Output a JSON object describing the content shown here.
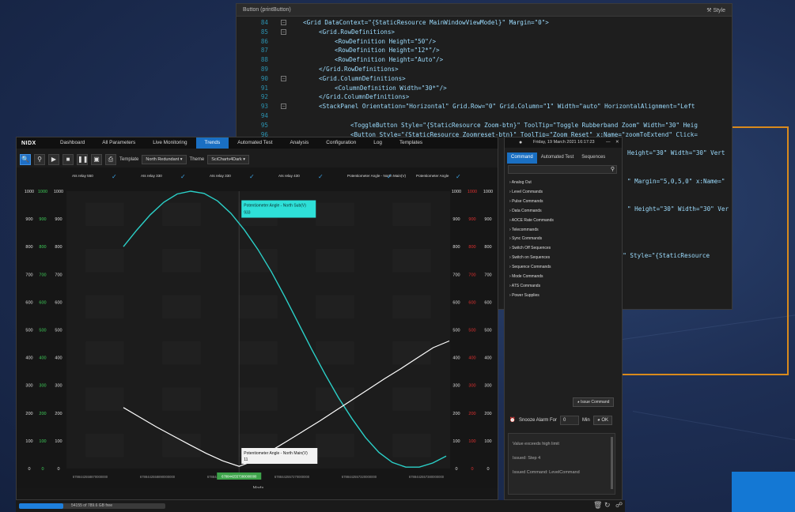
{
  "code_window": {
    "title": "Button (printButton)",
    "right_label": "Style",
    "lines": [
      {
        "num": "84",
        "code": "<Grid  DataContext=\"{StaticResource MainWindowViewModel}\" Margin=\"0\">"
      },
      {
        "num": "85",
        "code": "<Grid.RowDefinitions>"
      },
      {
        "num": "86",
        "code": "<RowDefinition Height=\"50\"/>"
      },
      {
        "num": "87",
        "code": "<RowDefinition Height=\"12*\"/>"
      },
      {
        "num": "88",
        "code": "<RowDefinition Height=\"Auto\"/>"
      },
      {
        "num": "89",
        "code": "</Grid.RowDefinitions>"
      },
      {
        "num": "90",
        "code": "<Grid.ColumnDefinitions>"
      },
      {
        "num": "91",
        "code": "<ColumnDefinition Width=\"30*\"/>"
      },
      {
        "num": "92",
        "code": "</Grid.ColumnDefinitions>"
      },
      {
        "num": "93",
        "code": "<StackPanel Orientation=\"Horizontal\" Grid.Row=\"0\" Grid.Column=\"1\" Width=\"auto\" HorizontalAlignment=\"Left"
      },
      {
        "num": "94",
        "code": ""
      },
      {
        "num": "95",
        "code": "<ToggleButton Style=\"{StaticResource Zoom-btn}\" ToolTip=\"Toggle Rubberband Zoom\" Width=\"30\" Heig"
      },
      {
        "num": "96",
        "code": "<Button Style=\"{StaticResource Zoomreset-btn}\" ToolTip=\"Zoom Reset\" x:Name=\"zoomToExtend\" Click="
      },
      {
        "num": "97",
        "code": ""
      },
      {
        "num": "98",
        "code": "Height=\"30\" Width=\"30\" Vert"
      },
      {
        "num": "99",
        "code": ""
      },
      {
        "num": "100",
        "code": ""
      },
      {
        "num": "101",
        "code": "\" Margin=\"5,0,5,0\" x:Name=\""
      },
      {
        "num": "102",
        "code": ""
      },
      {
        "num": "103",
        "code": ""
      },
      {
        "num": "104",
        "code": "\" Height=\"30\" Width=\"30\" Ver"
      },
      {
        "num": "105",
        "code": ""
      },
      {
        "num": "106",
        "code": ""
      },
      {
        "num": "107",
        "code": ""
      },
      {
        "num": "108",
        "code": ""
      },
      {
        "num": "109",
        "code": "nter\" Style=\"{StaticResource"
      }
    ]
  },
  "app": {
    "logo": "NIDX",
    "menu": [
      "Dashboard",
      "All Parameters",
      "Live Monitoring",
      "Trends",
      "Automated Test",
      "Analysis",
      "Configuration",
      "Log",
      "Templates"
    ],
    "active_menu": "Trends",
    "toolbar": {
      "template_label": "Template",
      "template_value": "North Redundant",
      "theme_label": "Theme",
      "theme_value": "SciChartv4Dark"
    },
    "series_headers": [
      "Ats relay 550",
      "Ats relay 330",
      "Ats relay 330",
      "Ats relay 430",
      "Potentiometer Angle - North Main(V)",
      "Potentiometer Angle"
    ],
    "x_axis_title": "Mods",
    "progress_text": "54155 of 789.6 GB free"
  },
  "chart_data": {
    "type": "line",
    "y_ticks": [
      1000,
      900,
      800,
      700,
      600,
      500,
      400,
      300,
      200,
      100,
      0
    ],
    "ylim": [
      0,
      1000
    ],
    "x_ticks": [
      "6788442558870000000",
      "6788442558890000000",
      "6788442558900000000",
      "6788442557270000000",
      "6788442557320000000",
      "6788442557380000000"
    ],
    "cursor_x_label": "6788442557380000000",
    "series": [
      {
        "name": "Potentiometer Angle - North Sub(V)",
        "color": "#2bd0c8",
        "y": [
          800,
          860,
          915,
          960,
          990,
          1000,
          992,
          965,
          920,
          860,
          790,
          710,
          620,
          525,
          430,
          340,
          255,
          180,
          112,
          58,
          22,
          5,
          5,
          20,
          45
        ]
      },
      {
        "name": "Potentiometer Angle - North Main(V)",
        "color": "#ffffff",
        "y": [
          220,
          185,
          150,
          118,
          86,
          55,
          28,
          8,
          30,
          65,
          100,
          136,
          172,
          210,
          248,
          286,
          324,
          360,
          398,
          436,
          460
        ]
      }
    ],
    "tooltips": [
      {
        "text": "Potentiometer Angle - North Sub(V)",
        "value": "933"
      },
      {
        "text": "Potentiometer Angle - North Main(V)",
        "value": "11"
      }
    ]
  },
  "side_panel": {
    "date": "Friday, 19 March 2021 16:17:23",
    "tabs": [
      "Command",
      "Automated Test",
      "Sequences"
    ],
    "active_tab": "Command",
    "commands": [
      "Analog Out",
      "Level Commands",
      "Pulse Commands",
      "Data Commands",
      "AOCE Rate Commands",
      "Telecommands",
      "Sync Commands",
      "Switch Off Sequences",
      "Switch on Sequences",
      "Sequence Commands",
      "Mode Commands",
      "ATS Commands",
      "Power Supplies"
    ],
    "issue_button": "Issue Command",
    "snooze_label": "Snooze Alarm For",
    "snooze_value": "0",
    "snooze_unit": "Min",
    "ok_label": "OK",
    "log": [
      "Value exceeds high limit",
      "Issued: Step 4",
      "Issued Command: LevelCommand"
    ]
  }
}
